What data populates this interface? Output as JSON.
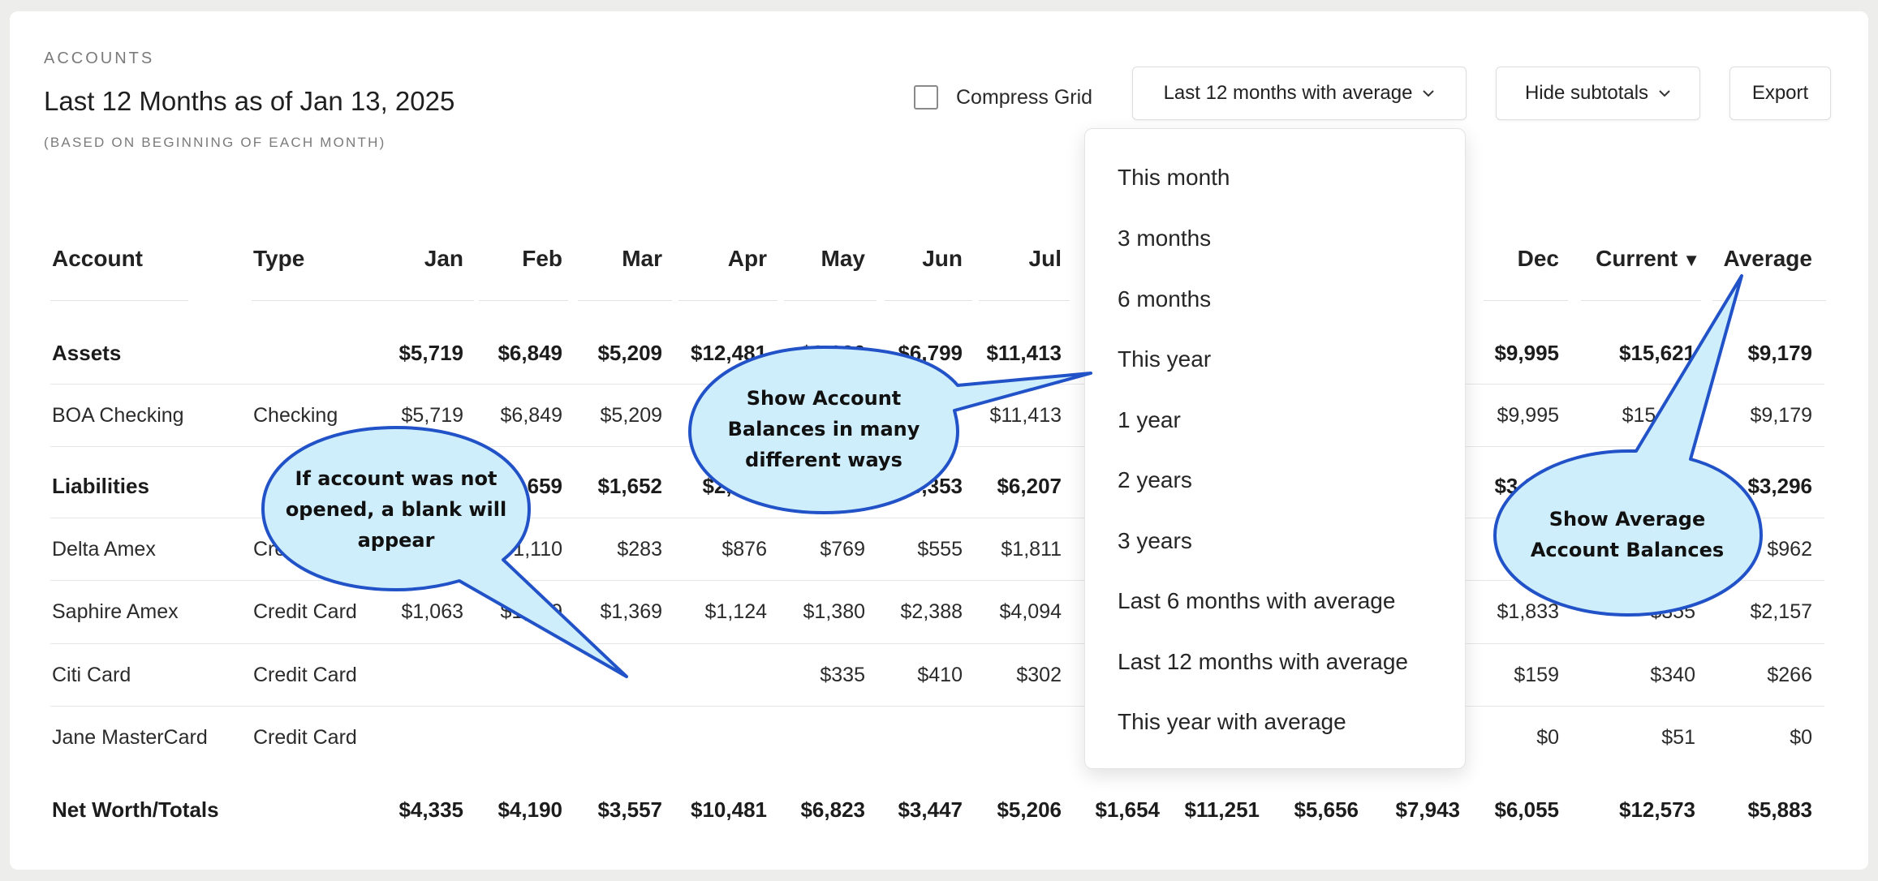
{
  "header": {
    "eyebrow": "ACCOUNTS",
    "title": "Last 12 Months as of Jan 13, 2025",
    "subtitle": "(BASED ON BEGINNING OF EACH MONTH)"
  },
  "toolbar": {
    "compress_label": "Compress Grid",
    "period_label": "Last 12 months with average",
    "subtotals_label": "Hide subtotals",
    "export_label": "Export"
  },
  "dropdown": {
    "items": [
      "This month",
      "3 months",
      "6 months",
      "This year",
      "1 year",
      "2 years",
      "3 years",
      "Last 6 months with average",
      "Last 12 months with average",
      "This year with average"
    ]
  },
  "table": {
    "headers": [
      "Account",
      "Type",
      "Jan",
      "Feb",
      "Mar",
      "Apr",
      "May",
      "Jun",
      "Jul",
      "Dec",
      "Current",
      "Average"
    ],
    "sort_glyph": "▼",
    "rows": [
      {
        "account": "Assets",
        "type": "",
        "bold": true,
        "values": {
          "Jan": "$5,719",
          "Feb": "$6,849",
          "Mar": "$5,209",
          "Apr": "$12,481",
          "May": "$9,036",
          "Jun": "$6,799",
          "Jul": "$11,413",
          "Dec": "$9,995",
          "Current": "$15,621",
          "Average": "$9,179"
        }
      },
      {
        "account": "BOA Checking",
        "type": "Checking",
        "bold": false,
        "values": {
          "Jan": "$5,719",
          "Feb": "$6,849",
          "Mar": "$5,209",
          "Jul": "$11,413",
          "Dec": "$9,995",
          "Current": "$15,621",
          "Average": "$9,179"
        }
      },
      {
        "account": "Liabilities",
        "type": "",
        "bold": true,
        "values": {
          "Feb": "$2,659",
          "Mar": "$1,652",
          "Apr": "$2,000",
          "Jun": "$3,353",
          "Jul": "$6,207",
          "Dec": "$3,940",
          "Average": "$3,296"
        }
      },
      {
        "account": "Delta Amex",
        "type": "Credit Card",
        "bold": false,
        "values": {
          "Feb": "$1,110",
          "Mar": "$283",
          "Apr": "$876",
          "May": "$769",
          "Jun": "$555",
          "Jul": "$1,811",
          "Average": "$962"
        }
      },
      {
        "account": "Saphire Amex",
        "type": "Credit Card",
        "bold": false,
        "values": {
          "Jan": "$1,063",
          "Feb": "$1,549",
          "Mar": "$1,369",
          "Apr": "$1,124",
          "May": "$1,380",
          "Jun": "$2,388",
          "Jul": "$4,094",
          "Dec": "$1,833",
          "Current": "$355",
          "Average": "$2,157"
        }
      },
      {
        "account": "Citi Card",
        "type": "Credit Card",
        "bold": false,
        "values": {
          "May": "$335",
          "Jun": "$410",
          "Jul": "$302",
          "Dec": "$159",
          "Current": "$340",
          "Average": "$266"
        }
      },
      {
        "account": "Jane MasterCard",
        "type": "Credit Card",
        "bold": false,
        "values": {
          "Dec": "$0",
          "Current": "$51",
          "Average": "$0"
        }
      },
      {
        "account": "Net Worth/Totals",
        "type": "",
        "bold": true,
        "values": {
          "Jan": "$4,335",
          "Feb": "$4,190",
          "Mar": "$3,557",
          "Apr": "$10,481",
          "May": "$6,823",
          "Jun": "$3,447",
          "Jul": "$5,206",
          "Aug": "$1,654",
          "Sep": "$11,251",
          "Oct": "$5,656",
          "Nov": "$7,943",
          "Dec": "$6,055",
          "Current": "$12,573",
          "Average": "$5,883"
        }
      }
    ]
  },
  "callouts": {
    "account_balances": "Show Account Balances in many different ways",
    "blank": "If account was not opened, a blank will appear",
    "average": "Show Average Account Balances"
  },
  "colors": {
    "callout_fill": "#cfeefc",
    "callout_stroke": "#2152c7"
  }
}
